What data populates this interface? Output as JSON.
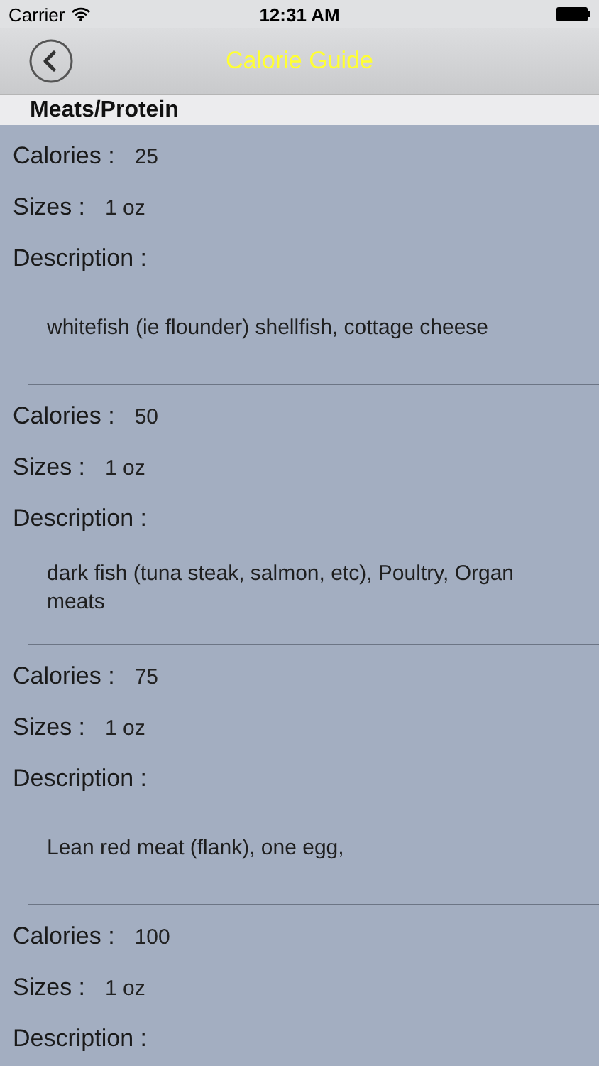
{
  "status_bar": {
    "carrier": "Carrier",
    "time": "12:31 AM"
  },
  "nav": {
    "title": "Calorie Guide"
  },
  "section": {
    "title": "Meats/Protein"
  },
  "entries": [
    {
      "calories_label": "Calories :",
      "calories": "25",
      "sizes_label": "Sizes :",
      "size": "1 oz",
      "description_label": "Description :",
      "description": "whitefish (ie flounder) shellfish, cottage cheese"
    },
    {
      "calories_label": "Calories :",
      "calories": "50",
      "sizes_label": "Sizes :",
      "size": "1 oz",
      "description_label": "Description :",
      "description": "dark fish (tuna steak, salmon, etc), Poultry, Organ meats"
    },
    {
      "calories_label": "Calories :",
      "calories": "75",
      "sizes_label": "Sizes :",
      "size": "1 oz",
      "description_label": "Description :",
      "description": "Lean red meat (flank), one egg,"
    },
    {
      "calories_label": "Calories :",
      "calories": "100",
      "sizes_label": "Sizes :",
      "size": "1 oz",
      "description_label": "Description :"
    }
  ]
}
